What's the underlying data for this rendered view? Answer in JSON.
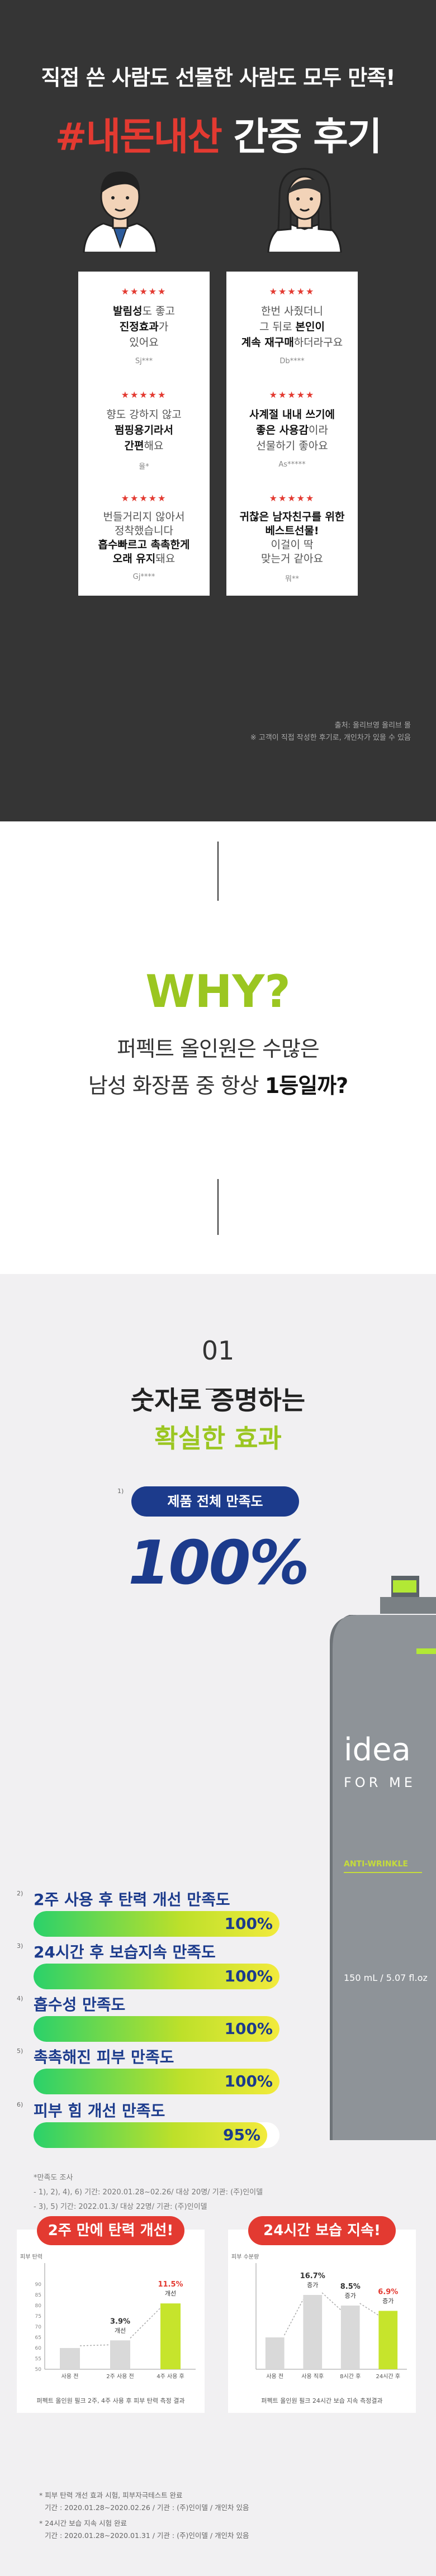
{
  "header": {
    "line1": "직접 쓴 사람도 선물한 사람도 모두 만족!",
    "big_highlight": "#내돈내산",
    "big_rest": " 간증 후기"
  },
  "reviews": [
    {
      "stars": "★★★★★",
      "pre": "",
      "b1": "발림성",
      "m1": "도 좋고",
      "b2": "진정효과",
      "m2": "가",
      "post": "있어요",
      "author": "Sj***"
    },
    {
      "stars": "★★★★★",
      "pre": "한번 사줬더니",
      "b1": "",
      "m1": "그 뒤로 ",
      "b2": "본인이",
      "m2": "",
      "post": "계속 재구매",
      "post2": "하더라구요",
      "author": "Db****"
    },
    {
      "stars": "★★★★★",
      "pre": "향도 강하지 않고",
      "b1": "펌핑용기라서",
      "m1": "",
      "b2": "간편",
      "m2": "해요",
      "post": "",
      "author": "율*"
    },
    {
      "stars": "★★★★★",
      "pre": "",
      "b1": "사계절 내내 쓰기에",
      "m1": "",
      "b2": "좋은 사용감",
      "m2": "이라",
      "post": "선물하기 좋아요",
      "author": "As*****"
    },
    {
      "stars": "★★★★★",
      "pre": "번들거리지 않아서",
      "b1": "",
      "m1": "정착했습니다",
      "b2": "흡수빠르고 촉촉한게",
      "m2": "",
      "post": "오래 유지",
      "post2": "돼요",
      "author": "Gj****"
    },
    {
      "stars": "★★★★★",
      "pre": "",
      "b1": "귀찮은 남자친구를 위한",
      "m1": "",
      "b2": "베스트선물!",
      "m2": "",
      "post": "이걸이 딱",
      "post2": "맞는거 같아요",
      "author": "뭐**"
    }
  ],
  "review_source": "출처: 올리브영 올리브 몰",
  "review_note": "※ 고객이 직접 작성한 후기로, 개인차가 있을 수 있음",
  "why": {
    "title": "WHY?",
    "line1": "퍼펙트 올인원은 수많은",
    "line2_pre": "남성 화장품 중 항상 ",
    "line2_bold": "1등일까?"
  },
  "efficacy": {
    "num": "01",
    "title1": "숫자로 증명하는",
    "title2": "확실한 효과",
    "pill_note": "1)",
    "pill": "제품 전체 만족도",
    "big": "100%",
    "bars": [
      {
        "note": "2)",
        "label": "2주 사용 후 탄력 개선 만족도",
        "value": 100,
        "text": "100%"
      },
      {
        "note": "3)",
        "label": "24시간 후 보습지속 만족도",
        "value": 100,
        "text": "100%"
      },
      {
        "note": "4)",
        "label": "흡수성 만족도",
        "value": 100,
        "text": "100%"
      },
      {
        "note": "5)",
        "label": "촉촉해진 피부 만족도",
        "value": 100,
        "text": "100%"
      },
      {
        "note": "6)",
        "label": "피부 힘 개선 만족도",
        "value": 95,
        "text": "95%"
      }
    ],
    "survey_title": "*만족도 조사",
    "survey_1": "- 1), 2), 4), 6) 기간: 2020.01.28~02.26/ 대상 20명/ 기관: (주)인이델",
    "survey_2": "- 3), 5) 기간: 2022.01.3/ 대상 22명/ 기관: (주)인이델"
  },
  "product": {
    "brand": "idea",
    "sub": "FOR ME",
    "line": "ANTI-WRINKLE",
    "volume": "150 mL / 5.07 fl.oz"
  },
  "chart_data": [
    {
      "type": "bar",
      "title": "2주 만에 탄력 개선!",
      "ylabel": "피부 탄력",
      "ylim": [
        50,
        100
      ],
      "ticks": [
        "90",
        "85",
        "80",
        "75",
        "70",
        "65",
        "60",
        "55",
        "50"
      ],
      "categories": [
        "사용 전",
        "2주 사용 전",
        "4주 사용 후"
      ],
      "values": [
        60,
        63.6,
        81
      ],
      "labels": [
        "",
        "3.9%\n개선",
        "11.5%\n개선"
      ],
      "footnote": "퍼펙트 올인원 필크 2주, 4주 사용 후 피부 탄력 측정 결과"
    },
    {
      "type": "bar",
      "title": "24시간 보습 지속!",
      "ylabel": "피부 수분량",
      "ylim": [
        0,
        100
      ],
      "categories": [
        "사용 전",
        "사용 직후",
        "8시간 후",
        "24시간 후"
      ],
      "values": [
        30,
        70,
        60,
        55
      ],
      "labels": [
        "",
        "16.7%\n증가",
        "8.5%\n증가",
        "6.9%\n증가"
      ],
      "footnote": "퍼펙트 올인원 필크 24시간 보습 지속 측정결과"
    }
  ],
  "notes": {
    "n1": "* 피부 탄력 개선 효과 시험, 피부자극테스트 완료",
    "n1d": "기간 : 2020.01.28~2020.02.26 / 기관 : (주)인이델 / 개인차 있음",
    "n2": "* 24시간 보습 지속 시험 완료",
    "n2d": "기간 : 2020.01.28~2020.01.31 / 기관 : (주)인이델 / 개인차 있음"
  },
  "colors": {
    "accent_red": "#e33a31",
    "navy": "#1c3b8c",
    "lime": "#9bc621"
  }
}
